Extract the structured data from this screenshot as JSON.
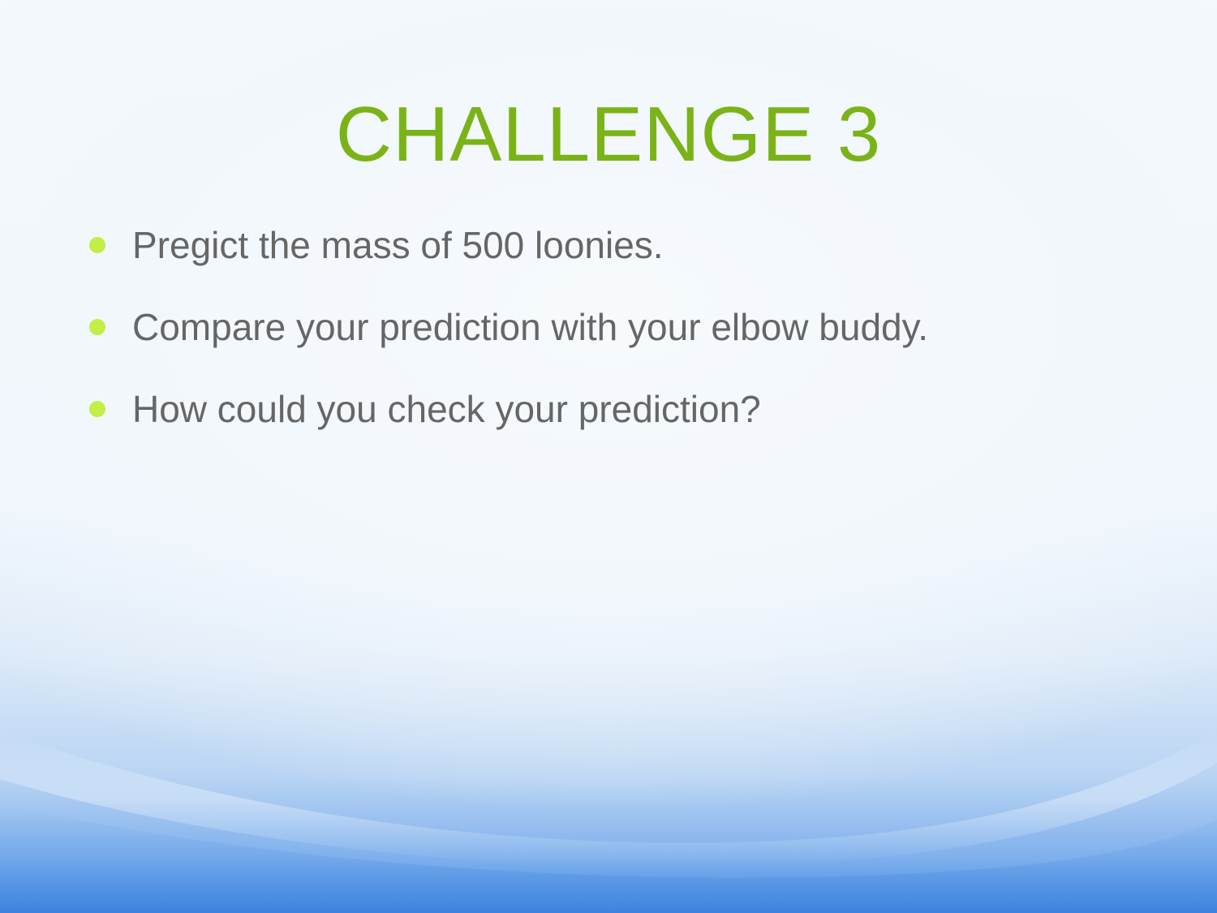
{
  "slide": {
    "title": "CHALLENGE 3",
    "bullets": [
      "Pregict the mass of 500 loonies.",
      "Compare your prediction with your elbow buddy.",
      "How could you check your prediction?"
    ]
  },
  "colors": {
    "title": "#7ab317",
    "bullet_dot": "#c1ef45",
    "body_text": "#666666",
    "background_top": "#f4f9fd",
    "background_bottom": "#3f86e0"
  }
}
